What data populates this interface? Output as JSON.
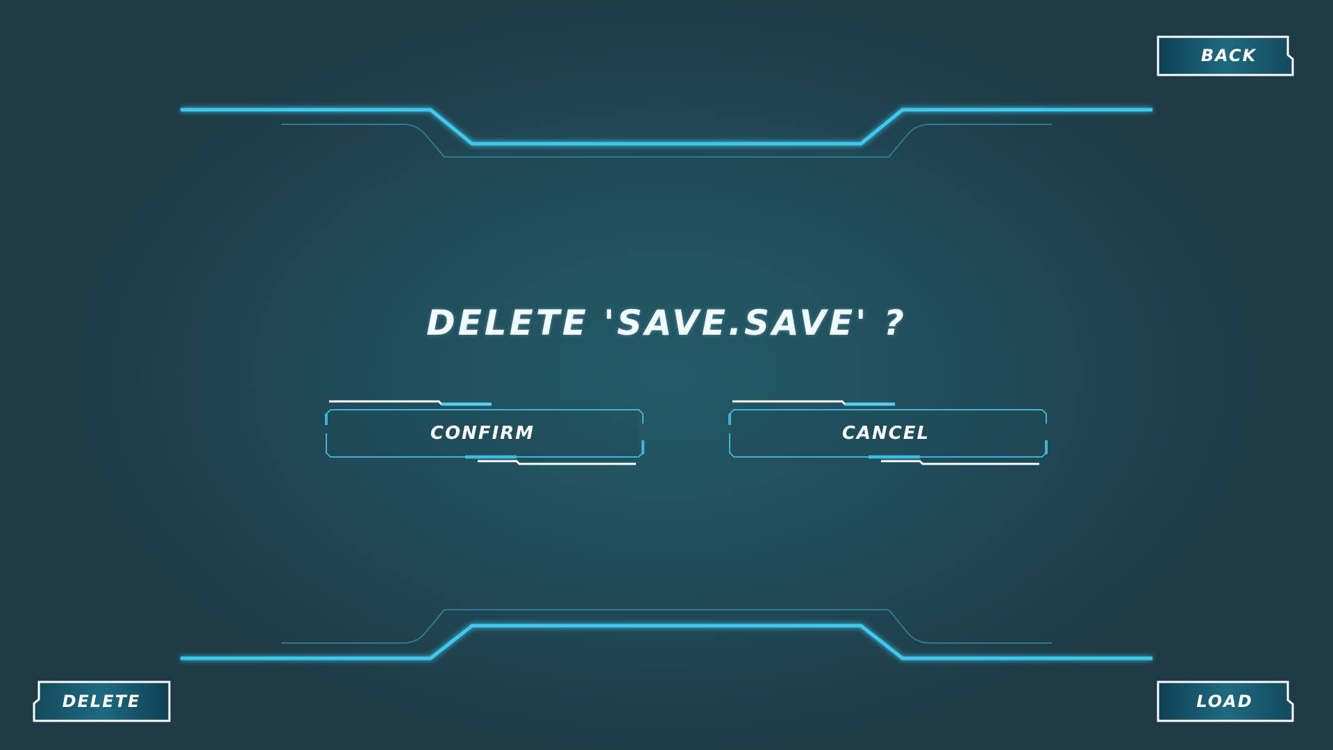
{
  "dialog": {
    "title": "Delete 'save.save' ?",
    "confirm_label": "Confirm",
    "cancel_label": "Cancel"
  },
  "corner_buttons": {
    "back_label": "Back",
    "delete_label": "Delete",
    "load_label": "Load"
  },
  "theme": {
    "background": "#1f4450",
    "accent": "#3fc9ee",
    "text": "#ffffff"
  }
}
